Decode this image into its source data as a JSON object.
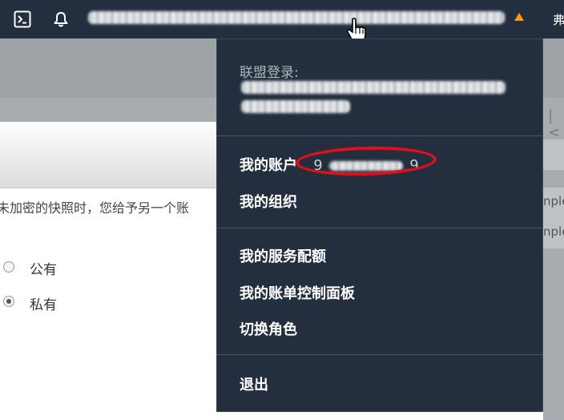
{
  "topbar": {
    "terminal_icon": "terminal-icon",
    "bell_icon": "bell-icon",
    "account_alert_icon": "warning-triangle-icon",
    "right_text": "弗"
  },
  "main": {
    "description": "未加密的快照时，您给予另一个账",
    "visibility_options": [
      {
        "label": "公有",
        "checked": false
      },
      {
        "label": "私有",
        "checked": true
      }
    ],
    "right_partial_rows": [
      "nple",
      "nple"
    ]
  },
  "dropdown": {
    "federated_login_label": "联盟登录:",
    "account_label": "我的账户",
    "account_number_start": "9",
    "account_number_end": "9",
    "items": {
      "organization": "我的组织",
      "service_quotas": "我的服务配额",
      "billing_dashboard": "我的账单控制面板",
      "switch_role": "切换角色",
      "sign_out": "退出"
    }
  },
  "colors": {
    "topbar_bg": "#232f3e",
    "accent_orange": "#ff9900",
    "highlight_red": "#e0101a"
  }
}
